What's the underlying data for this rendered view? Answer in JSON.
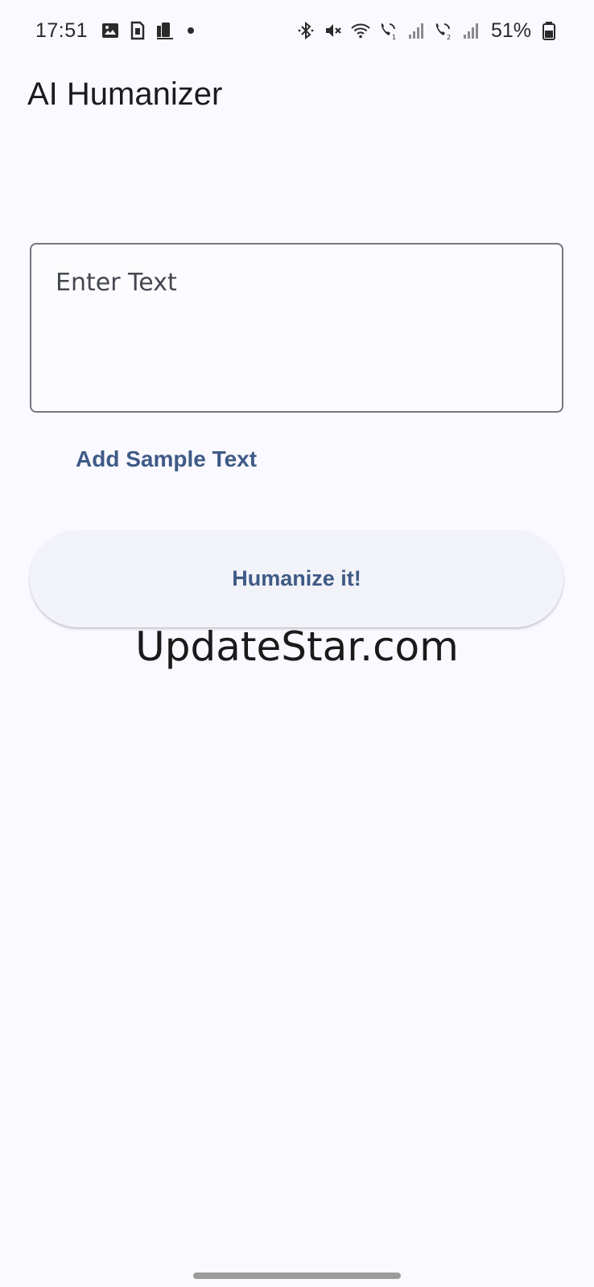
{
  "status_bar": {
    "time": "17:51",
    "battery": "51%",
    "left_icons": [
      "gallery-icon",
      "sim-card-icon",
      "phone-link-icon",
      "notification-dot-icon"
    ],
    "right_icons": [
      "bluetooth-icon",
      "mute-icon",
      "wifi-icon",
      "wifi-call-sim1-icon",
      "signal-sim1-icon",
      "wifi-call-sim2-icon",
      "signal-sim2-icon",
      "battery-icon"
    ]
  },
  "app": {
    "title": "AI Humanizer"
  },
  "input": {
    "placeholder": "Enter Text",
    "value": ""
  },
  "actions": {
    "sample_label": "Add Sample Text",
    "humanize_label": "Humanize it!"
  },
  "watermark": "UpdateStar.com",
  "colors": {
    "background": "#f9f9ff",
    "accent": "#3f5a86",
    "outline": "#74777f",
    "button_surface": "#f2f3f8"
  }
}
